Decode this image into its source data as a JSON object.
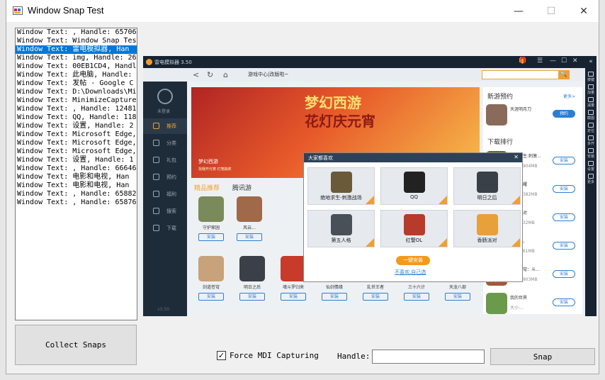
{
  "window": {
    "title": "Window Snap Test",
    "min_glyph": "—",
    "max_glyph": "☐",
    "close_glyph": "✕"
  },
  "list": {
    "items": [
      "Window Text: , Handle: 65706",
      "Window Text: Window Snap Tes",
      "Window Text: 雷电模拟器, Han",
      "Window Text: img, Handle: 26",
      "Window Text: 00EB1CD4, Handl",
      "Window Text: 此电脑, Handle:",
      "Window Text: 发帖 - Google C",
      "Window Text: D:\\Downloads\\Mi",
      "Window Text: MinimizeCapture",
      "Window Text: , Handle: 12481",
      "Window Text: QQ, Handle: 118",
      "Window Text: 设置, Handle: 2",
      "Window Text: Microsoft Edge,",
      "Window Text: Microsoft Edge,",
      "Window Text: Microsoft Edge,",
      "Window Text: 设置, Handle: 1",
      "Window Text: , Handle: 66646",
      "Window Text: 电影和电视, Han",
      "Window Text: 电影和电视, Han",
      "Window Text: , Handle: 65882",
      "Window Text: , Handle: 65876"
    ],
    "selected_index": 2
  },
  "controls": {
    "collect_label": "Collect Snaps",
    "force_mdi_label": "Force MDI Capturing",
    "force_mdi_checked": true,
    "check_glyph": "✓",
    "handle_label": "Handle:",
    "handle_value": "",
    "snap_label": "Snap"
  },
  "emulator": {
    "title": "雷电模拟器 3.50",
    "url_text": "游戏中心|改版啦~",
    "nav": {
      "back": "<",
      "refresh": "↻",
      "home": "⌂"
    },
    "search_glyph": "🔍",
    "ctl": {
      "gift": "🎁",
      "menu": "☰",
      "min": "—",
      "max": "☐",
      "close": "✕",
      "collapse": "«"
    },
    "avatar_label": "未登录",
    "sidebar": [
      "推荐",
      "分类",
      "礼包",
      "预约",
      "福利",
      "搜索",
      "下载"
    ],
    "version": "v3.50",
    "banner": {
      "logo": "梦幻西游",
      "title": "花灯庆元宵",
      "caption": "梦幻西游",
      "sub": "找我开元宵·灯笼抽奖"
    },
    "tabs": [
      "精品推荐",
      "腾讯游"
    ],
    "games_row1": [
      {
        "name": "守护家园",
        "color": "#7b8a5a"
      },
      {
        "name": "风云...",
        "color": "#a06a4a"
      }
    ],
    "games_row2": [
      {
        "name": "剑道苍穹",
        "color": "#c8a27a"
      },
      {
        "name": "明日之后",
        "color": "#3a3f48"
      },
      {
        "name": "魂斗罗归来",
        "color": "#c83a2a"
      },
      {
        "name": "仙剑情缘",
        "color": "#d6b0a0"
      },
      {
        "name": "乱世王者",
        "color": "#a83a2a"
      },
      {
        "name": "三十六计",
        "color": "#b85a2a"
      },
      {
        "name": "天龙八部",
        "color": "#a02a2a"
      }
    ],
    "install_label": "安装",
    "right_panel": {
      "reserve_title": "新游预约",
      "more": "更多>",
      "reserve": {
        "name": "天涯明月刀",
        "btn": "预约",
        "color": "#8a6a5a"
      },
      "rank_title": "下载排行",
      "rank": [
        {
          "name": "绝地求生:刺激...",
          "size": "大小:1904MB",
          "color": "#5a6a3a"
        },
        {
          "name": "王者荣耀",
          "size": "大小:1382MB",
          "color": "#c83a3a"
        },
        {
          "name": "香肠派对",
          "size": "大小:532MB",
          "color": "#e8a03a"
        },
        {
          "name": "红警OL",
          "size": "大小:461MB",
          "color": "#d03a2a"
        },
        {
          "name": "斗破苍穹：斗...",
          "size": "大小:1903MB",
          "color": "#a05a3a"
        },
        {
          "name": "我的世界",
          "size": "大小:...",
          "color": "#6a9a4a"
        }
      ]
    },
    "right_bar": [
      "按键",
      "加量",
      "减量",
      "截图",
      "定位",
      "多开",
      "安装",
      "设置",
      "更多"
    ],
    "modal": {
      "title": "大家都喜欢",
      "close": "✕",
      "apps": [
        {
          "name": "绝地求生-刺激战场",
          "color": "#6a5a3a"
        },
        {
          "name": "QQ",
          "color": "#222222"
        },
        {
          "name": "明日之后",
          "color": "#3a4048"
        },
        {
          "name": "第五人格",
          "color": "#4a5058"
        },
        {
          "name": "红警OL",
          "color": "#b83a2a"
        },
        {
          "name": "香肠派对",
          "color": "#e8a03a"
        }
      ],
      "install_btn": "一键安装",
      "skip_link": "不喜欢,自己选"
    }
  }
}
